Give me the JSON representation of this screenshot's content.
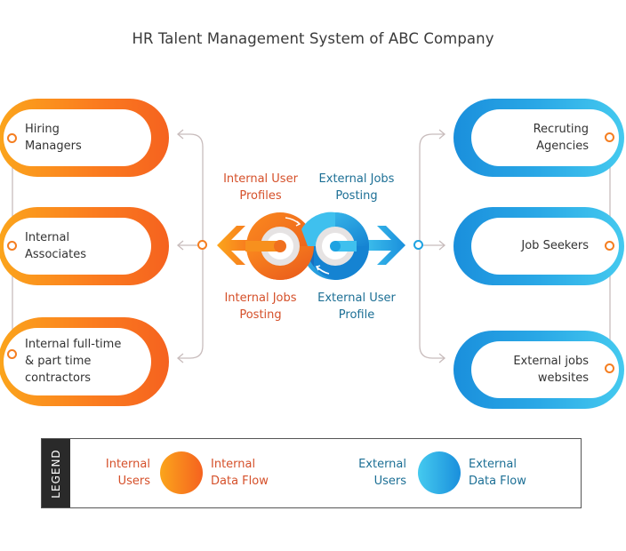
{
  "title": "HR Talent Management System of ABC Company",
  "colors": {
    "internal_accent": "#f57e20",
    "internal_text": "#d5502a",
    "external_accent": "#1da2e2",
    "external_text": "#1c6f95",
    "connector": "#c8bcbc"
  },
  "internal_users": [
    {
      "line1": "Hiring",
      "line2": "Managers",
      "line3": ""
    },
    {
      "line1": "Internal",
      "line2": "Associates",
      "line3": ""
    },
    {
      "line1": "Internal full-time",
      "line2": "& part time",
      "line3": "contractors"
    }
  ],
  "external_users": [
    {
      "line1": "Recruting",
      "line2": "Agencies"
    },
    {
      "line1": "Job Seekers",
      "line2": ""
    },
    {
      "line1": "External jobs",
      "line2": "websites"
    }
  ],
  "center": {
    "top_left": {
      "line1": "Internal User",
      "line2": "Profiles"
    },
    "top_right": {
      "line1": "External Jobs",
      "line2": "Posting"
    },
    "bottom_left": {
      "line1": "Internal Jobs",
      "line2": "Posting"
    },
    "bottom_right": {
      "line1": "External User",
      "line2": "Profile"
    }
  },
  "legend": {
    "title": "LEGEND",
    "internal_users": {
      "line1": "Internal",
      "line2": "Users"
    },
    "internal_flow": {
      "line1": "Internal",
      "line2": "Data Flow"
    },
    "external_users": {
      "line1": "External",
      "line2": "Users"
    },
    "external_flow": {
      "line1": "External",
      "line2": "Data Flow"
    }
  }
}
